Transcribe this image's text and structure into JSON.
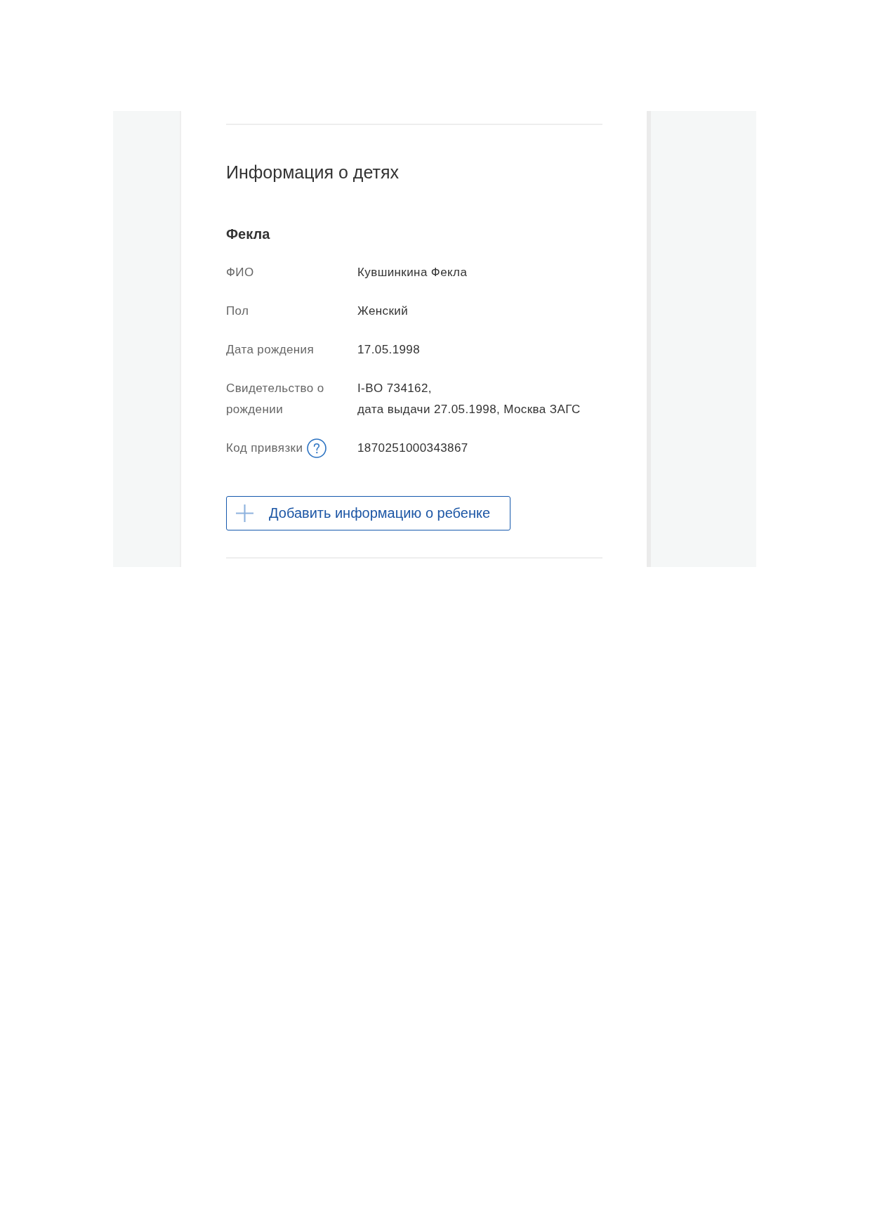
{
  "section_title": "Информация о детях",
  "children": [
    {
      "name": "Фекла",
      "fields": [
        {
          "label": "ФИО",
          "value_lines": [
            "Кувшинкина Фекла"
          ],
          "has_help": false
        },
        {
          "label": "Пол",
          "value_lines": [
            "Женский"
          ],
          "has_help": false
        },
        {
          "label": "Дата рождения",
          "value_lines": [
            "17.05.1998"
          ],
          "has_help": false
        },
        {
          "label": "Свидетельство о рождении",
          "value_lines": [
            "I-BO 734162,",
            "дата выдачи 27.05.1998, Москва ЗАГС"
          ],
          "has_help": false
        },
        {
          "label": "Код привязки",
          "value_lines": [
            "1870251000343867"
          ],
          "has_help": true
        }
      ]
    }
  ],
  "add_button": {
    "label": "Добавить информацию о ребенке"
  }
}
